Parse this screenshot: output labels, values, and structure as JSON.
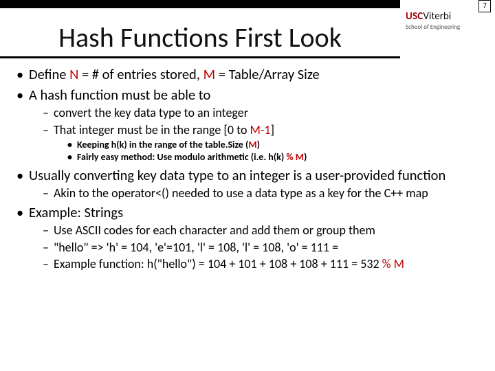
{
  "page_number": "7",
  "logo": {
    "usc": "USC",
    "viterbi": "Viterbi",
    "sub": "School of Engineering"
  },
  "title": "Hash Functions First Look",
  "b1": {
    "pre": "Define ",
    "N": "N",
    "mid1": " = # of entries stored, ",
    "M": "M",
    "post": " = Table/Array Size"
  },
  "b2": "A hash function must be able to",
  "b2a": "convert the key data type to an integer",
  "b2b": {
    "pre": "That integer must be in the range [0 to ",
    "mm1": "M-1",
    "post": "]"
  },
  "b2b1": {
    "pre": "Keeping h(k) in the range of the table.Size (",
    "M": "M",
    "post": ")"
  },
  "b2b2": {
    "pre": "Fairly easy method:  Use modulo arithmetic (i.e. h(k) ",
    "modm": "% M",
    "post": ")"
  },
  "b3": "Usually converting key data type to an integer is a user-provided function",
  "b3a": "Akin to the operator<() needed to use a data type as a key for the C++ map",
  "b4": "Example: Strings",
  "b4a": "Use ASCII codes for each character and add them or group them",
  "b4b": "\"hello\" => 'h' = 104, 'e'=101, 'l' = 108, 'l' = 108, 'o' = 111 =",
  "b4c": {
    "pre": "Example function: h(\"hello\") = 104 + 101 + 108 + 108 + 111 = 532 ",
    "modm": "% M"
  }
}
